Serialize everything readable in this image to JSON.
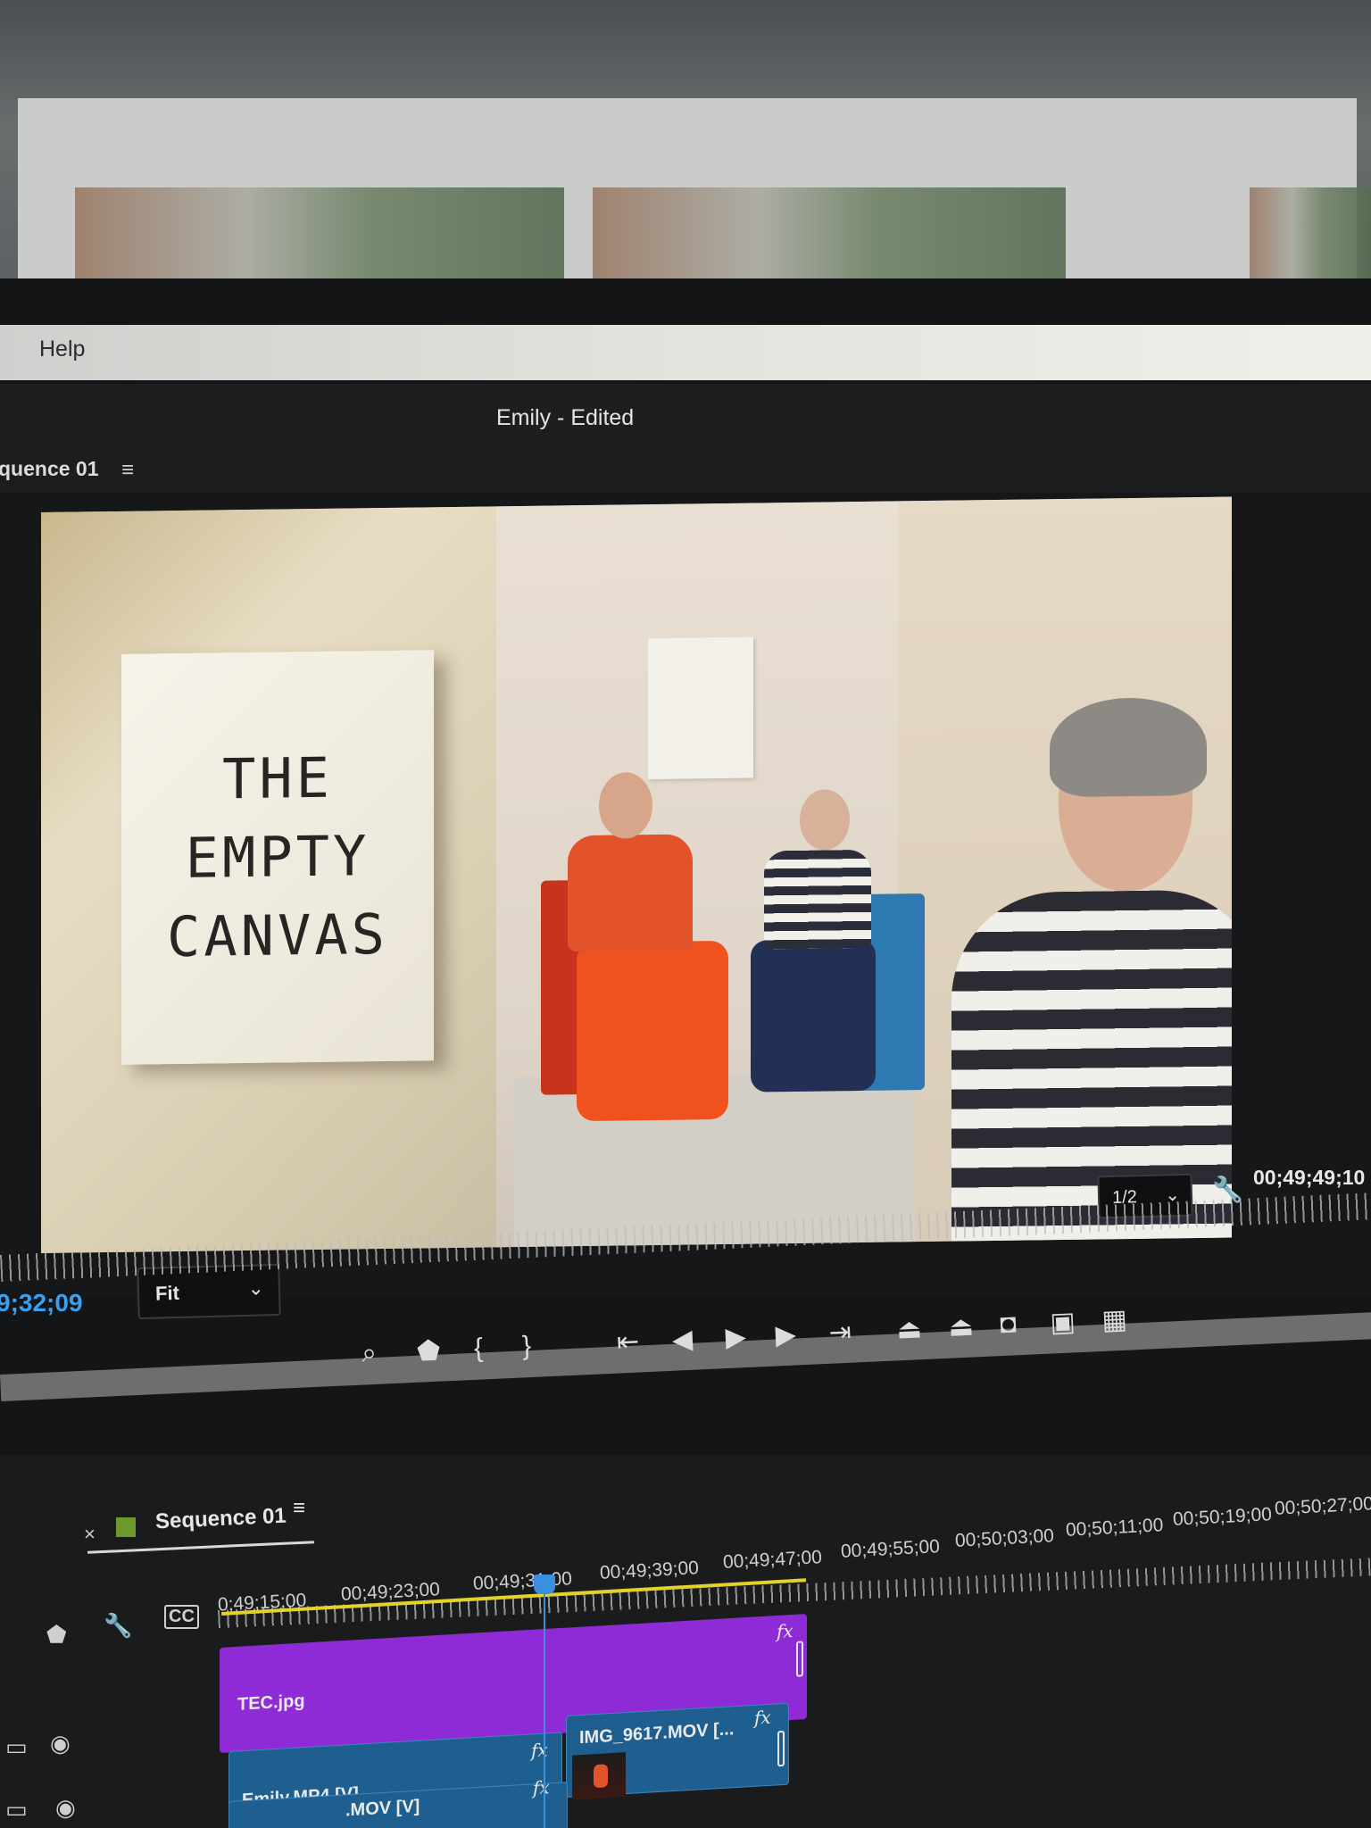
{
  "menu": {
    "help": "Help"
  },
  "app": {
    "title": "Emily - Edited"
  },
  "program_monitor": {
    "tab_label": "quence 01",
    "menu_icon": "hamburger-icon",
    "canvas_text": [
      "THE",
      "EMPTY",
      "CANVAS"
    ],
    "current_timecode": "9;32;09",
    "zoom": "Fit",
    "resolution": "1/2",
    "duration_timecode": "00;49;49;10",
    "transport_icons": [
      "marker-out-icon",
      "add-marker-icon",
      "mark-in-icon",
      "mark-out-icon",
      "go-to-in-icon",
      "step-back-icon",
      "play-icon",
      "step-forward-icon",
      "go-to-out-icon",
      "lift-icon",
      "extract-icon",
      "export-frame-icon",
      "comparison-view-icon",
      "proxy-toggle-icon"
    ]
  },
  "timeline": {
    "close": "×",
    "tab_label": "Sequence 01",
    "menu_icon": "hamburger-icon",
    "swatch_color": "#6c9a2a",
    "timecodes": [
      "0;49;15;00",
      "00;49;23;00",
      "00;49;31;00",
      "00;49;39;00",
      "00;49;47;00",
      "00;49;55;00",
      "00;50;03;00",
      "00;50;11;00",
      "00;50;19;00",
      "00;50;27;00"
    ],
    "tools": [
      "snap-icon",
      "marker-icon",
      "wrench-icon",
      "captions-icon"
    ],
    "captions_label": "CC",
    "fx_label": "fx",
    "clips": {
      "tec": "TEC.jpg",
      "emily": "Emily.MP4 [V]",
      "img9617": "IMG_9617.MOV [...",
      "lower": ".MOV [V]"
    }
  },
  "colors": {
    "accent_blue": "#3aa0f0",
    "clip_purple": "#8e2bd6",
    "clip_blue": "#1f5f8f",
    "work_area": "#e3d22a"
  }
}
